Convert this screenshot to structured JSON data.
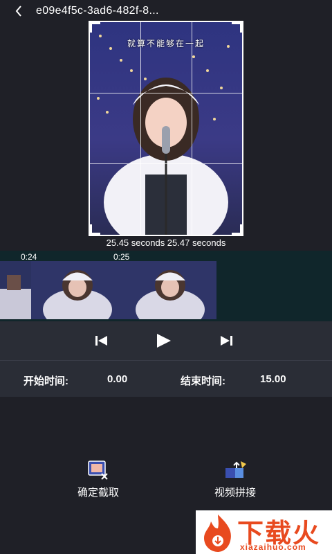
{
  "header": {
    "title": "e09e4f5c-3ad6-482f-8...",
    "back_icon": "chevron-left-icon"
  },
  "preview": {
    "overlay_text": "就算不能够在一起",
    "time_range": "25.45 seconds 25.47 seconds"
  },
  "timeline": {
    "ticks": [
      "0:24",
      "0:25"
    ]
  },
  "controls": {
    "previous_icon": "skip-previous-icon",
    "play_icon": "play-icon",
    "next_icon": "skip-next-icon"
  },
  "times": {
    "start_label": "开始时间:",
    "start_value": "0.00",
    "end_label": "结束时间:",
    "end_value": "15.00"
  },
  "actions": {
    "crop_label": "确定截取",
    "crop_icon": "crop-screen-icon",
    "concat_label": "视频拼接",
    "concat_icon": "video-concat-icon"
  },
  "watermark": {
    "brand": "下载火",
    "url": "xiazaihuo.com"
  },
  "colors": {
    "background": "#1f2027",
    "panel": "#2a2d36",
    "timeline_bg": "#10262b",
    "brand_orange": "#e84a1f"
  }
}
